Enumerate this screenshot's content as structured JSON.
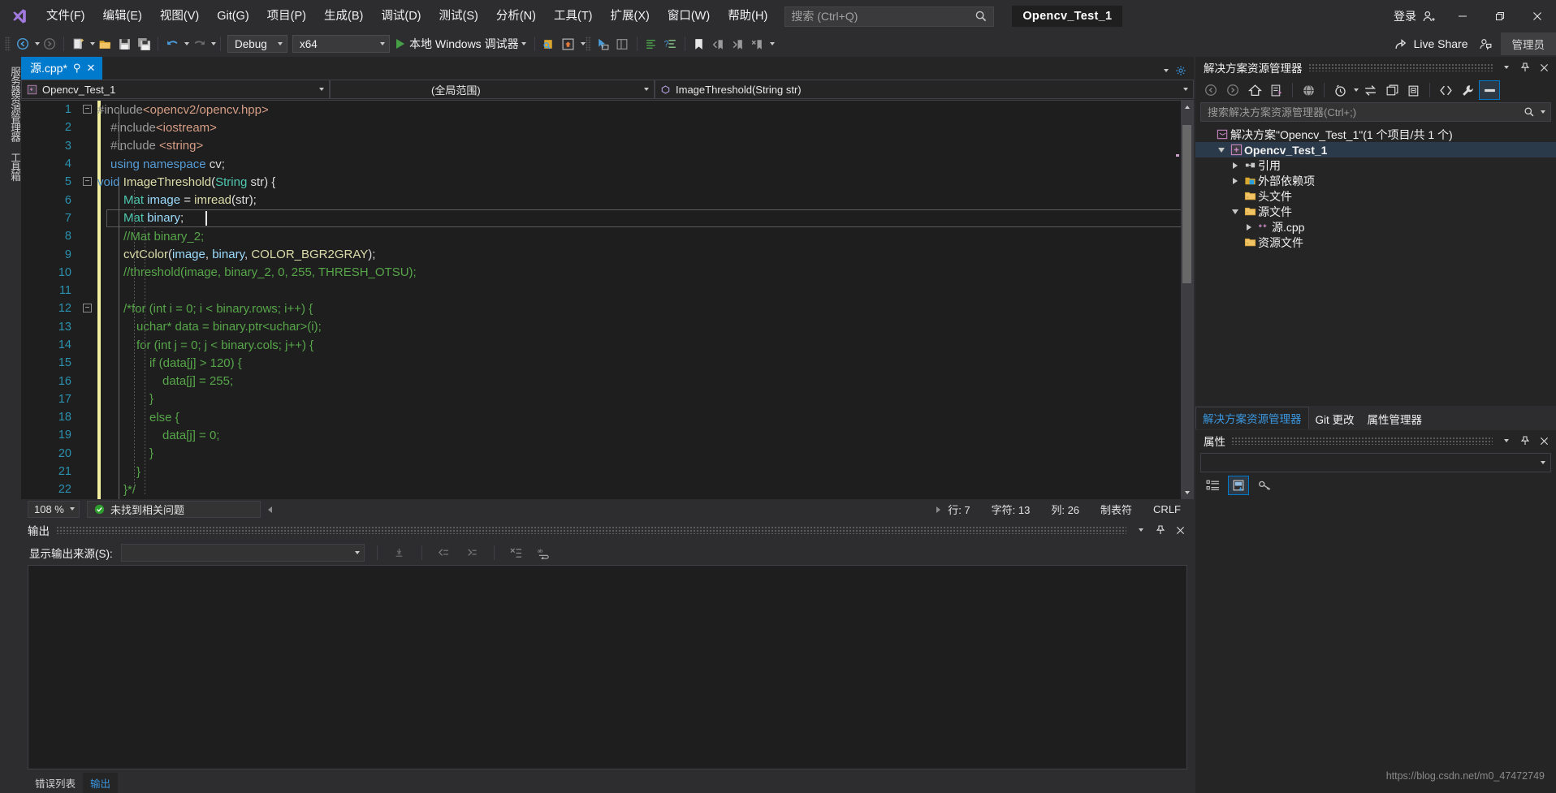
{
  "titlebar": {
    "menu": [
      {
        "label": "文件(F)",
        "name": "menu-file"
      },
      {
        "label": "编辑(E)",
        "name": "menu-edit"
      },
      {
        "label": "视图(V)",
        "name": "menu-view"
      },
      {
        "label": "Git(G)",
        "name": "menu-git"
      },
      {
        "label": "项目(P)",
        "name": "menu-project"
      },
      {
        "label": "生成(B)",
        "name": "menu-build"
      },
      {
        "label": "调试(D)",
        "name": "menu-debug"
      },
      {
        "label": "测试(S)",
        "name": "menu-test"
      },
      {
        "label": "分析(N)",
        "name": "menu-analyze"
      },
      {
        "label": "工具(T)",
        "name": "menu-tools"
      },
      {
        "label": "扩展(X)",
        "name": "menu-extensions"
      },
      {
        "label": "窗口(W)",
        "name": "menu-window"
      },
      {
        "label": "帮助(H)",
        "name": "menu-help"
      }
    ],
    "search_placeholder": "搜索 (Ctrl+Q)",
    "search_value": "",
    "solution_name": "Opencv_Test_1",
    "signin_label": "登录",
    "minimize": "—",
    "restore": "❐",
    "close": "✕"
  },
  "toolbar": {
    "config": "Debug",
    "platform": "x64",
    "debug_target": "本地 Windows 调试器",
    "live_share": "Live Share",
    "admin_label": "管理员"
  },
  "left_strip": {
    "tabs": [
      "服务器资源管理器",
      "工具箱"
    ]
  },
  "editor": {
    "tab": {
      "label": "源.cpp*",
      "pin": "⚲",
      "close": "✕"
    },
    "nav_left": "Opencv_Test_1",
    "nav_mid": "(全局范围)",
    "nav_right": "ImageThreshold(String str)",
    "lines": [
      {
        "n": "1",
        "fold": "minus",
        "segments": [
          {
            "t": "#include",
            "c": "pp"
          },
          {
            "t": "<opencv2/opencv.hpp>",
            "c": "str"
          }
        ]
      },
      {
        "n": "2",
        "fold": "",
        "indent": 1,
        "segments": [
          {
            "t": "#include",
            "c": "pp"
          },
          {
            "t": "<iostream>",
            "c": "str"
          }
        ]
      },
      {
        "n": "3",
        "fold": "",
        "indent": 1,
        "segments": [
          {
            "t": "#include ",
            "c": "pp"
          },
          {
            "t": "<string>",
            "c": "str"
          }
        ]
      },
      {
        "n": "4",
        "fold": "",
        "indent": 1,
        "segments": [
          {
            "t": "using namespace",
            "c": "k"
          },
          {
            "t": " ",
            "c": "pl"
          },
          {
            "t": "cv",
            "c": "pl"
          },
          {
            "t": ";",
            "c": "pl"
          }
        ]
      },
      {
        "n": "5",
        "fold": "minus",
        "segments": [
          {
            "t": "void",
            "c": "k"
          },
          {
            "t": " ",
            "c": "pl"
          },
          {
            "t": "ImageThreshold",
            "c": "fn"
          },
          {
            "t": "(",
            "c": "pl"
          },
          {
            "t": "String",
            "c": "ty"
          },
          {
            "t": " str",
            "c": "pl"
          },
          {
            "t": ") {",
            "c": "pl"
          }
        ]
      },
      {
        "n": "6",
        "fold": "",
        "indent": 2,
        "segments": [
          {
            "t": "Mat",
            "c": "ty"
          },
          {
            "t": " ",
            "c": "pl"
          },
          {
            "t": "image",
            "c": "id"
          },
          {
            "t": " = ",
            "c": "pl"
          },
          {
            "t": "imread",
            "c": "fn"
          },
          {
            "t": "(",
            "c": "pl"
          },
          {
            "t": "str",
            "c": "pl"
          },
          {
            "t": ");",
            "c": "pl"
          }
        ]
      },
      {
        "n": "7",
        "fold": "",
        "indent": 2,
        "current": true,
        "segments": [
          {
            "t": "Mat",
            "c": "ty"
          },
          {
            "t": " ",
            "c": "pl"
          },
          {
            "t": "binary",
            "c": "id"
          },
          {
            "t": ";",
            "c": "pl"
          }
        ]
      },
      {
        "n": "8",
        "fold": "",
        "indent": 2,
        "segments": [
          {
            "t": "//Mat binary_2;",
            "c": "cm"
          }
        ]
      },
      {
        "n": "9",
        "fold": "",
        "indent": 2,
        "segments": [
          {
            "t": "cvtColor",
            "c": "fn"
          },
          {
            "t": "(",
            "c": "pl"
          },
          {
            "t": "image",
            "c": "id"
          },
          {
            "t": ", ",
            "c": "pl"
          },
          {
            "t": "binary",
            "c": "id"
          },
          {
            "t": ", ",
            "c": "pl"
          },
          {
            "t": "COLOR_BGR2GRAY",
            "c": "fn"
          },
          {
            "t": ");",
            "c": "pl"
          }
        ]
      },
      {
        "n": "10",
        "fold": "",
        "indent": 2,
        "segments": [
          {
            "t": "//threshold(image, binary_2, 0, 255, THRESH_OTSU);",
            "c": "cm"
          }
        ]
      },
      {
        "n": "11",
        "fold": "",
        "indent": 2,
        "segments": []
      },
      {
        "n": "12",
        "fold": "minus",
        "indent": 2,
        "segments": [
          {
            "t": "/*for (int i = 0; i < binary.rows; i++) {",
            "c": "cm"
          }
        ]
      },
      {
        "n": "13",
        "fold": "",
        "indent": 3,
        "segments": [
          {
            "t": "uchar* data = binary.ptr<uchar>(i);",
            "c": "cm"
          }
        ]
      },
      {
        "n": "14",
        "fold": "",
        "indent": 3,
        "segments": [
          {
            "t": "for (int j = 0; j < binary.cols; j++) {",
            "c": "cm"
          }
        ]
      },
      {
        "n": "15",
        "fold": "",
        "indent": 4,
        "segments": [
          {
            "t": "if (data[j] > 120) {",
            "c": "cm"
          }
        ]
      },
      {
        "n": "16",
        "fold": "",
        "indent": 5,
        "segments": [
          {
            "t": "data[j] = 255;",
            "c": "cm"
          }
        ]
      },
      {
        "n": "17",
        "fold": "",
        "indent": 4,
        "segments": [
          {
            "t": "}",
            "c": "cm"
          }
        ]
      },
      {
        "n": "18",
        "fold": "",
        "indent": 4,
        "segments": [
          {
            "t": "else {",
            "c": "cm"
          }
        ]
      },
      {
        "n": "19",
        "fold": "",
        "indent": 5,
        "segments": [
          {
            "t": "data[j] = 0;",
            "c": "cm"
          }
        ]
      },
      {
        "n": "20",
        "fold": "",
        "indent": 4,
        "segments": [
          {
            "t": "}",
            "c": "cm"
          }
        ]
      },
      {
        "n": "21",
        "fold": "",
        "indent": 3,
        "segments": [
          {
            "t": "}",
            "c": "cm"
          }
        ]
      },
      {
        "n": "22",
        "fold": "",
        "indent": 2,
        "segments": [
          {
            "t": "}*/",
            "c": "cm"
          }
        ]
      }
    ]
  },
  "editor_status": {
    "zoom": "108 %",
    "issues": "未找到相关问题",
    "row": "行: 7",
    "chars": "字符: 13",
    "col": "列: 26",
    "tabs": "制表符",
    "eol": "CRLF"
  },
  "output": {
    "title": "输出",
    "source_label": "显示输出来源(S):",
    "source_value": "",
    "bottom_tabs": [
      {
        "label": "错误列表",
        "active": false
      },
      {
        "label": "输出",
        "active": true
      }
    ]
  },
  "solution_explorer": {
    "title": "解决方案资源管理器",
    "search_placeholder": "搜索解决方案资源管理器(Ctrl+;)",
    "search_value": "",
    "tree": [
      {
        "label": "解决方案\"Opencv_Test_1\"(1 个项目/共 1 个)",
        "indent": 0,
        "twisty": "none",
        "icon": "solution-icon",
        "bold": false,
        "name": "tree-item-solution"
      },
      {
        "label": "Opencv_Test_1",
        "indent": 1,
        "twisty": "down",
        "icon": "project-icon",
        "bold": true,
        "name": "tree-item-project"
      },
      {
        "label": "引用",
        "indent": 2,
        "twisty": "right",
        "icon": "references-icon",
        "bold": false,
        "name": "tree-item-references"
      },
      {
        "label": "外部依赖项",
        "indent": 2,
        "twisty": "right",
        "icon": "external-deps-icon",
        "bold": false,
        "name": "tree-item-external-dependencies"
      },
      {
        "label": "头文件",
        "indent": 2,
        "twisty": "none",
        "icon": "folder-icon",
        "bold": false,
        "name": "tree-item-header-files"
      },
      {
        "label": "源文件",
        "indent": 2,
        "twisty": "down",
        "icon": "folder-icon",
        "bold": false,
        "name": "tree-item-source-files"
      },
      {
        "label": "源.cpp",
        "indent": 3,
        "twisty": "right",
        "icon": "cpp-file-icon",
        "bold": false,
        "name": "tree-item-source-cpp"
      },
      {
        "label": "资源文件",
        "indent": 2,
        "twisty": "none",
        "icon": "folder-icon",
        "bold": false,
        "name": "tree-item-resource-files"
      }
    ],
    "tabs": [
      {
        "label": "解决方案资源管理器",
        "active": true
      },
      {
        "label": "Git 更改",
        "active": false
      },
      {
        "label": "属性管理器",
        "active": false
      }
    ]
  },
  "properties": {
    "title": "属性",
    "selected_value": ""
  },
  "watermark": "https://blog.csdn.net/m0_47472749",
  "colors": {
    "accent": "#007acc",
    "titlebar_bg": "#2d2d30",
    "editor_bg": "#1e1e1e",
    "panel_bg": "#252526",
    "comment_green": "#57a64a",
    "keyword_blue": "#569cd6",
    "type_teal": "#4ec9b0",
    "function_yellow": "#dcdcaa",
    "changebar_yellow": "#f2f0a0"
  }
}
